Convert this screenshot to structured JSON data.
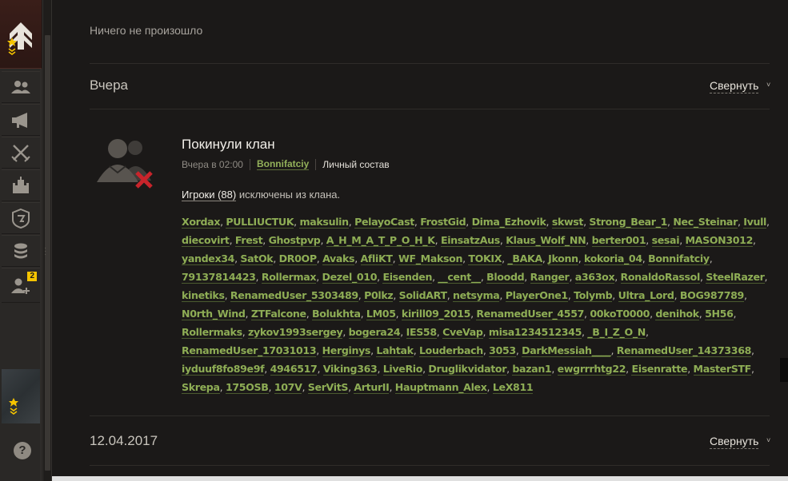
{
  "sidebar": {
    "items": [
      {
        "name": "members",
        "icon": "people-icon"
      },
      {
        "name": "announcements",
        "icon": "megaphone-icon"
      },
      {
        "name": "battles",
        "icon": "crossed-swords-icon"
      },
      {
        "name": "stronghold",
        "icon": "fortress-icon"
      },
      {
        "name": "clan-emblem",
        "icon": "shield-icon"
      },
      {
        "name": "treasury",
        "icon": "coins-icon"
      },
      {
        "name": "recruitment",
        "icon": "add-person-icon",
        "badge": "2"
      }
    ],
    "help_label": "?"
  },
  "feed": {
    "nothing_happened": "Ничего не произошло",
    "yesterday": {
      "title": "Вчера",
      "collapse_label": "Свернуть"
    },
    "event": {
      "title": "Покинули клан",
      "time": "Вчера в 02:00",
      "author": "Bonnifatciy",
      "section": "Личный состав",
      "players_label": "Игроки (88)",
      "summary_rest": " исключены из клана."
    },
    "older_day": {
      "title": "12.04.2017",
      "collapse_label": "Свернуть"
    }
  },
  "players": [
    "Xordax",
    "PULLIUCTUK",
    "maksulin",
    "PelayoCast",
    "FrostGid",
    "Dima_Ezhovik",
    "skwst",
    "Strong_Bear_1",
    "Nec_Steinar",
    "Ivull",
    "diecovirt",
    "Frest",
    "Ghostpvp",
    "A_H_M_A_T_P_O_H_K",
    "EinsatzAus",
    "Klaus_Wolf_NN",
    "berter001",
    "sesai",
    "MASON3012",
    "yandex34",
    "SatOk",
    "DR0OP",
    "Avaks",
    "AfliKT",
    "WF_Makson",
    "TOKIX",
    "_BAKA",
    "Jkonn",
    "kokoria_04",
    "Bonnifatciy",
    "79137814423",
    "Rollermax",
    "Dezel_010",
    "Eisenden",
    "__cent__",
    "Bloodd",
    "Ranger",
    "a363ox",
    "RonaldoRassol",
    "SteelRazer",
    "kinetiks",
    "RenamedUser_5303489",
    "P0lkz",
    "SolidART",
    "netsyma",
    "PlayerOne1",
    "Tolymb",
    "Ultra_Lord",
    "BOG987789",
    "N0rth_Wind",
    "ZTFalcone",
    "Bolukhta",
    "LM05",
    "kirill09_2015",
    "RenamedUser_4557",
    "00koT0000",
    "denihok",
    "5H56",
    "Rollermaks",
    "zykov1993sergey",
    "bogera24",
    "IES58",
    "CveVap",
    "misa1234512345",
    "_B_I_Z_O_N",
    "RenamedUser_17031013",
    "Herginys",
    "Lahtak",
    "Louderbach",
    "3053",
    "DarkMessiah____",
    "RenamedUser_14373368",
    "iyduuf8fo89e9f",
    "4946517",
    "Viking363",
    "LiveRio",
    "Druglikvidator",
    "bazan1",
    "ewgrrrhtg22",
    "Eisenratte",
    "MasterSTF",
    "Skrepa",
    "175OSB",
    "107V",
    "SerVitS",
    "ArturII",
    "Hauptmann_Alex",
    "LeX811"
  ],
  "colors": {
    "background": "#1b1918",
    "player_link": "#8ead55",
    "badge": "#f5c400",
    "remove_mark": "#c8242b"
  }
}
